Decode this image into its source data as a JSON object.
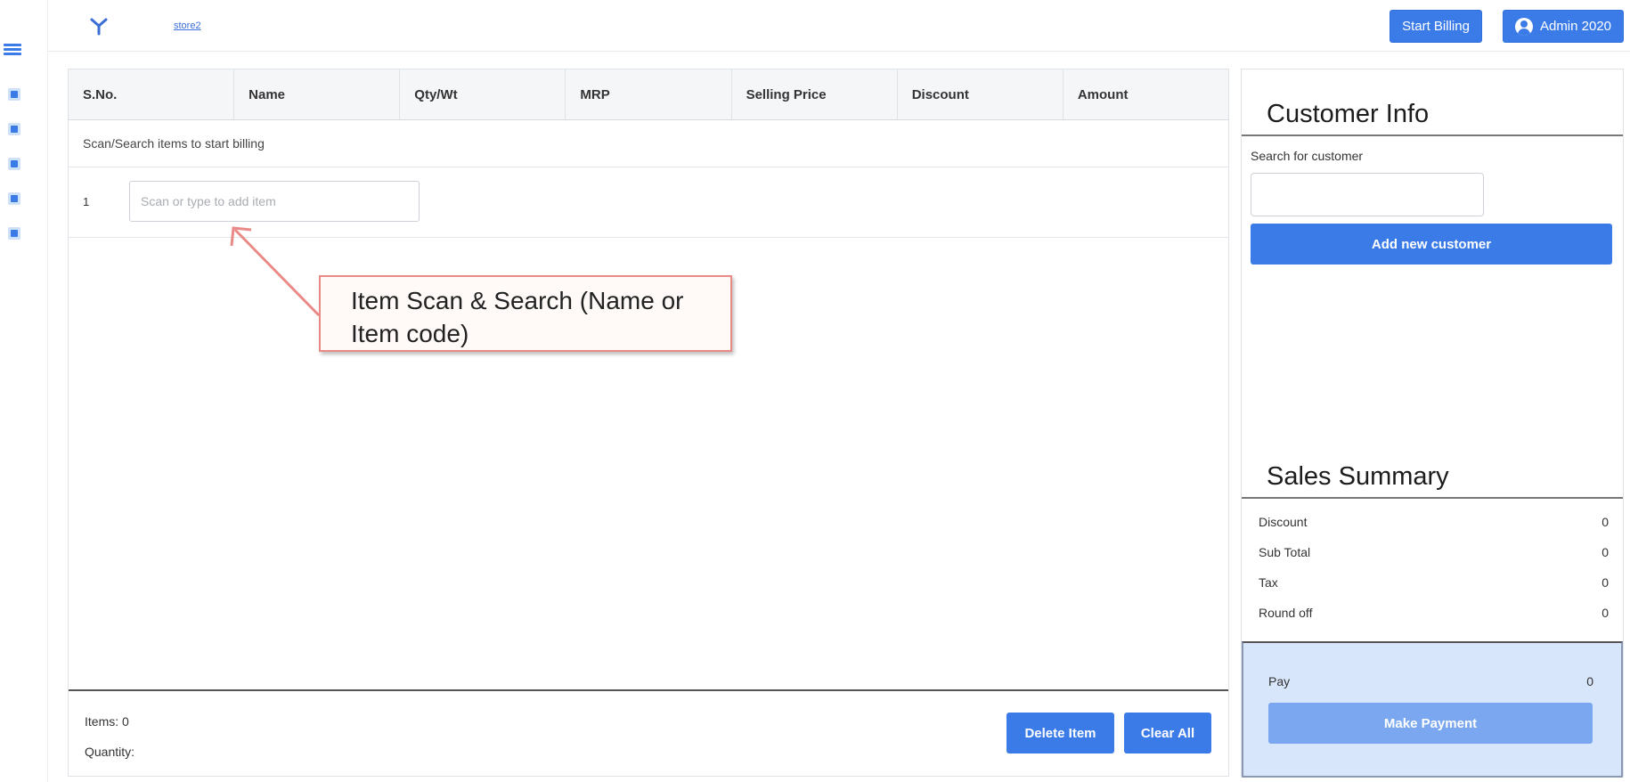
{
  "rail": {
    "icons": [
      "menu-icon",
      "dashboard-icon",
      "inventory-icon",
      "store-icon",
      "groups-icon",
      "reports-icon"
    ]
  },
  "header": {
    "store_name": "store2",
    "start_billing_label": "Start Billing",
    "admin_label": "Admin 2020"
  },
  "table": {
    "columns": [
      "S.No.",
      "Name",
      "Qty/Wt",
      "MRP",
      "Selling Price",
      "Discount",
      "Amount"
    ],
    "hint": "Scan/Search items to start billing",
    "row_number": "1",
    "scan_placeholder": "Scan or type to add item"
  },
  "footer": {
    "items_text": "Items: 0",
    "quantity_text": "Quantity:",
    "delete_label": "Delete Item",
    "clear_label": "Clear All"
  },
  "callout": {
    "text": "Item Scan & Search (Name or Item code)"
  },
  "customer": {
    "title": "Customer Info",
    "search_label": "Search for customer",
    "search_value": "",
    "add_label": "Add new customer"
  },
  "summary": {
    "title": "Sales Summary",
    "rows": [
      {
        "label": "Discount",
        "value": "0"
      },
      {
        "label": "Sub Total",
        "value": "0"
      },
      {
        "label": "Tax",
        "value": "0"
      },
      {
        "label": "Round off",
        "value": "0"
      }
    ],
    "pay_label": "Pay",
    "pay_value": "0",
    "make_payment_label": "Make Payment"
  },
  "colors": {
    "accent": "#3b7be8",
    "pay_box": "#d8e6fb",
    "callout_border": "#e98a86"
  }
}
